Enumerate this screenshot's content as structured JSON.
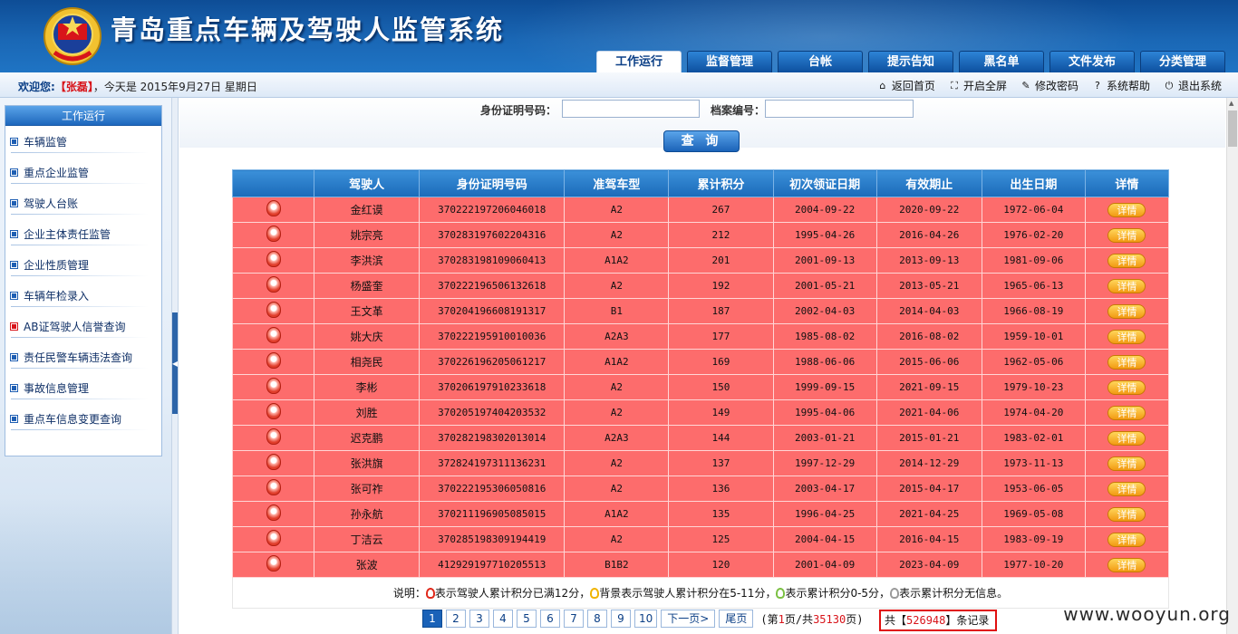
{
  "header": {
    "title": "青岛重点车辆及驾驶人监管系统",
    "tabs": [
      {
        "label": "工作运行",
        "active": true
      },
      {
        "label": "监督管理"
      },
      {
        "label": "台帐"
      },
      {
        "label": "提示告知"
      },
      {
        "label": "黑名单"
      },
      {
        "label": "文件发布"
      },
      {
        "label": "分类管理"
      }
    ]
  },
  "welcome": {
    "prefix": "欢迎您:",
    "user": "【张磊】",
    "date_text": "，今天是 2015年9月27日 星期日"
  },
  "toplinks": [
    {
      "label": "返回首页",
      "icon": "home-icon",
      "glyph": "⌂"
    },
    {
      "label": "开启全屏",
      "icon": "fullscreen-icon",
      "glyph": "⛶"
    },
    {
      "label": "修改密码",
      "icon": "key-icon",
      "glyph": "✎"
    },
    {
      "label": "系统帮助",
      "icon": "help-icon",
      "glyph": "?"
    },
    {
      "label": "退出系统",
      "icon": "logout-icon",
      "glyph": "⏻"
    }
  ],
  "sidebar": {
    "header": "工作运行",
    "items": [
      {
        "label": "车辆监管"
      },
      {
        "label": "重点企业监管"
      },
      {
        "label": "驾驶人台账"
      },
      {
        "label": "企业主体责任监管"
      },
      {
        "label": "企业性质管理"
      },
      {
        "label": "车辆年检录入"
      },
      {
        "label": "AB证驾驶人信誉查询",
        "active": true
      },
      {
        "label": "责任民警车辆违法查询"
      },
      {
        "label": "事故信息管理"
      },
      {
        "label": "重点车信息变更查询"
      }
    ]
  },
  "search": {
    "id_label": "身份证明号码：",
    "id_value": "",
    "file_label": "档案编号：",
    "file_value": "",
    "button": "查 询"
  },
  "table": {
    "columns": [
      "",
      "驾驶人",
      "身份证明号码",
      "准驾车型",
      "累计积分",
      "初次领证日期",
      "有效期止",
      "出生日期",
      "详情"
    ],
    "detail_label": "详情",
    "rows": [
      [
        "金红谟",
        "370222197206046018",
        "A2",
        "267",
        "2004-09-22",
        "2020-09-22",
        "1972-06-04"
      ],
      [
        "姚宗亮",
        "370283197602204316",
        "A2",
        "212",
        "1995-04-26",
        "2016-04-26",
        "1976-02-20"
      ],
      [
        "李洪滨",
        "370283198109060413",
        "A1A2",
        "201",
        "2001-09-13",
        "2013-09-13",
        "1981-09-06"
      ],
      [
        "杨盛奎",
        "370222196506132618",
        "A2",
        "192",
        "2001-05-21",
        "2013-05-21",
        "1965-06-13"
      ],
      [
        "王文革",
        "370204196608191317",
        "B1",
        "187",
        "2002-04-03",
        "2014-04-03",
        "1966-08-19"
      ],
      [
        "姚大庆",
        "370222195910010036",
        "A2A3",
        "177",
        "1985-08-02",
        "2016-08-02",
        "1959-10-01"
      ],
      [
        "相尧民",
        "370226196205061217",
        "A1A2",
        "169",
        "1988-06-06",
        "2015-06-06",
        "1962-05-06"
      ],
      [
        "李彬",
        "370206197910233618",
        "A2",
        "150",
        "1999-09-15",
        "2021-09-15",
        "1979-10-23"
      ],
      [
        "刘胜",
        "370205197404203532",
        "A2",
        "149",
        "1995-04-06",
        "2021-04-06",
        "1974-04-20"
      ],
      [
        "迟克鹏",
        "370282198302013014",
        "A2A3",
        "144",
        "2003-01-21",
        "2015-01-21",
        "1983-02-01"
      ],
      [
        "张洪旗",
        "372824197311136231",
        "A2",
        "137",
        "1997-12-29",
        "2014-12-29",
        "1973-11-13"
      ],
      [
        "张可祚",
        "370222195306050816",
        "A2",
        "136",
        "2003-04-17",
        "2015-04-17",
        "1953-06-05"
      ],
      [
        "孙永航",
        "370211196905085015",
        "A1A2",
        "135",
        "1996-04-25",
        "2021-04-25",
        "1969-05-08"
      ],
      [
        "丁洁云",
        "370285198309194419",
        "A2",
        "125",
        "2004-04-15",
        "2016-04-15",
        "1983-09-19"
      ],
      [
        "张波",
        "412929197710205513",
        "B1B2",
        "120",
        "2001-04-09",
        "2023-04-09",
        "1977-10-20"
      ]
    ]
  },
  "legend": {
    "prefix": "说明：",
    "items": [
      {
        "text": "表示驾驶人累计积分已满12分，",
        "color": "#e0281a"
      },
      {
        "text": "背景表示驾驶人累计积分在5-11分，",
        "color": "#f0b400"
      },
      {
        "text": "表示累计积分0-5分，",
        "color": "#7bc043"
      },
      {
        "text": "表示累计积分无信息。",
        "color": "#9a9a9a"
      }
    ]
  },
  "pager": {
    "pages": [
      "1",
      "2",
      "3",
      "4",
      "5",
      "6",
      "7",
      "8",
      "9",
      "10"
    ],
    "current": "1",
    "next": "下一页>",
    "last": "尾页",
    "info_prefix": "(第",
    "info_page": "1",
    "info_mid": "页/共",
    "info_total_pages": "35130",
    "info_suffix": "页)",
    "total_prefix": "共【",
    "total_records": "526948",
    "total_suffix": "】条记录"
  },
  "watermark": "www.wooyun.org",
  "colors": {
    "header_blue": "#1a67b5",
    "row_red": "#fd6c6c",
    "highlight_red": "#e01010"
  }
}
